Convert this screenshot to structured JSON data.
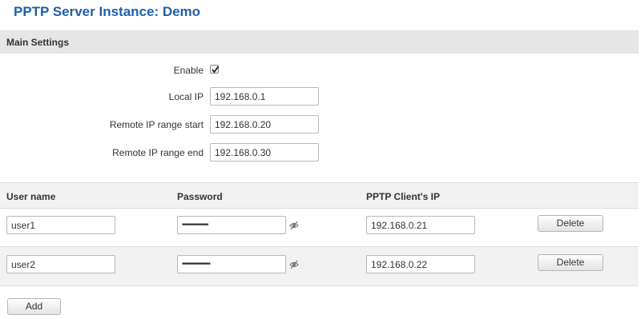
{
  "page": {
    "title": "PPTP Server Instance: Demo"
  },
  "main_settings": {
    "header": "Main Settings",
    "enable": {
      "label": "Enable",
      "checked": true
    },
    "local_ip": {
      "label": "Local IP",
      "value": "192.168.0.1"
    },
    "remote_start": {
      "label": "Remote IP range start",
      "value": "192.168.0.20"
    },
    "remote_end": {
      "label": "Remote IP range end",
      "value": "192.168.0.30"
    }
  },
  "users_table": {
    "headers": {
      "username": "User name",
      "password": "Password",
      "client_ip": "PPTP Client's IP"
    },
    "rows": [
      {
        "username": "user1",
        "password": "•••••••••••••",
        "client_ip": "192.168.0.21",
        "delete_label": "Delete"
      },
      {
        "username": "user2",
        "password": "••••••••••••••",
        "client_ip": "192.168.0.22",
        "delete_label": "Delete"
      }
    ],
    "add_label": "Add"
  },
  "colors": {
    "title": "#1f5fa8",
    "section_bg": "#e6e6e6",
    "row_alt_bg": "#f2f2f2"
  },
  "icons": {
    "enable": "checkmark-icon",
    "password_toggle": "eye-slash-icon"
  }
}
